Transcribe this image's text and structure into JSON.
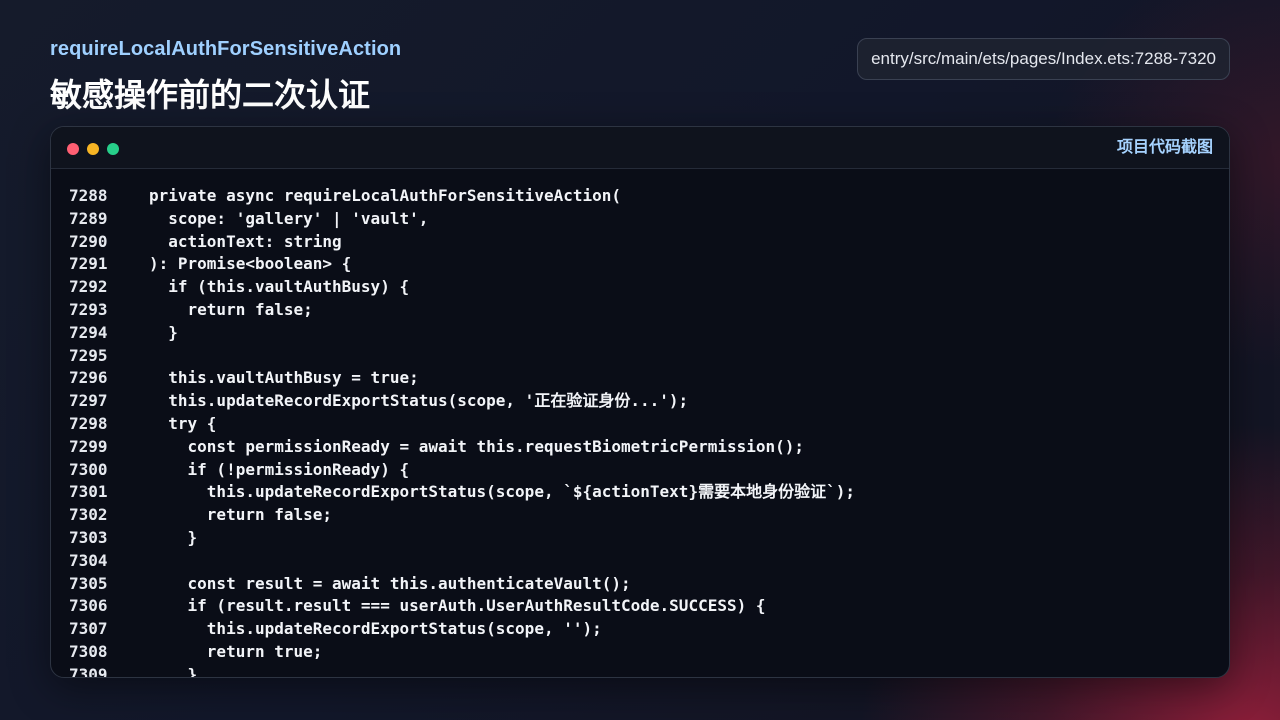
{
  "header": {
    "kicker": "requireLocalAuthForSensitiveAction",
    "title": "敏感操作前的二次认证",
    "file_path": "entry/src/main/ets/pages/Index.ets:7288-7320"
  },
  "window": {
    "label": "项目代码截图",
    "controls": [
      "close",
      "minimize",
      "maximize"
    ]
  },
  "code": {
    "lines": [
      {
        "num": "7288",
        "text": "private async requireLocalAuthForSensitiveAction("
      },
      {
        "num": "7289",
        "text": "  scope: 'gallery' | 'vault',"
      },
      {
        "num": "7290",
        "text": "  actionText: string"
      },
      {
        "num": "7291",
        "text": "): Promise<boolean> {"
      },
      {
        "num": "7292",
        "text": "  if (this.vaultAuthBusy) {"
      },
      {
        "num": "7293",
        "text": "    return false;"
      },
      {
        "num": "7294",
        "text": "  }"
      },
      {
        "num": "7295",
        "text": ""
      },
      {
        "num": "7296",
        "text": "  this.vaultAuthBusy = true;"
      },
      {
        "num": "7297",
        "text": "  this.updateRecordExportStatus(scope, '正在验证身份...');"
      },
      {
        "num": "7298",
        "text": "  try {"
      },
      {
        "num": "7299",
        "text": "    const permissionReady = await this.requestBiometricPermission();"
      },
      {
        "num": "7300",
        "text": "    if (!permissionReady) {"
      },
      {
        "num": "7301",
        "text": "      this.updateRecordExportStatus(scope, `${actionText}需要本地身份验证`);"
      },
      {
        "num": "7302",
        "text": "      return false;"
      },
      {
        "num": "7303",
        "text": "    }"
      },
      {
        "num": "7304",
        "text": ""
      },
      {
        "num": "7305",
        "text": "    const result = await this.authenticateVault();"
      },
      {
        "num": "7306",
        "text": "    if (result.result === userAuth.UserAuthResultCode.SUCCESS) {"
      },
      {
        "num": "7307",
        "text": "      this.updateRecordExportStatus(scope, '');"
      },
      {
        "num": "7308",
        "text": "      return true;"
      },
      {
        "num": "7309",
        "text": "    }"
      }
    ]
  }
}
